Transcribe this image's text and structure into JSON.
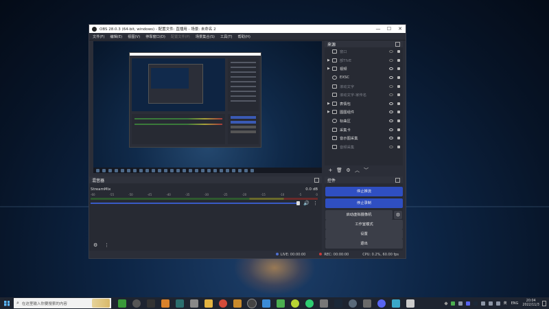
{
  "window": {
    "title": "OBS 28.0.3 (64-bit, windows) - 配置文件: 直播用 - 场景: 未命名 2",
    "controls": [
      "—",
      "☐",
      "✕"
    ]
  },
  "menu": [
    {
      "label": "文件(F)",
      "enabled": true
    },
    {
      "label": "编辑(E)",
      "enabled": true
    },
    {
      "label": "视图(V)",
      "enabled": true
    },
    {
      "label": "停靠窗口(D)",
      "enabled": true
    },
    {
      "label": "配置文件(P)",
      "enabled": false
    },
    {
      "label": "场景集合(S)",
      "enabled": true
    },
    {
      "label": "工具(T)",
      "enabled": true
    },
    {
      "label": "帮助(H)",
      "enabled": true
    }
  ],
  "sources": {
    "title": "来源",
    "items": [
      {
        "label": "窗口",
        "group": false,
        "visible": false
      },
      {
        "label": "部TIVE",
        "group": true,
        "visible": false
      },
      {
        "label": "视频",
        "group": true,
        "visible": true
      },
      {
        "label": "EXSC",
        "group": false,
        "visible": true
      },
      {
        "label": "滚动文字",
        "group": false,
        "visible": false
      },
      {
        "label": "滚动文字-家传名",
        "group": false,
        "visible": false
      },
      {
        "label": "表情包",
        "group": true,
        "visible": true
      },
      {
        "label": "图图组件",
        "group": true,
        "visible": true
      },
      {
        "label": "标曲区",
        "group": false,
        "visible": true
      },
      {
        "label": "采集卡",
        "group": false,
        "visible": true
      },
      {
        "label": "音示图采集",
        "group": false,
        "visible": true
      },
      {
        "label": "音频采集",
        "group": false,
        "visible": false
      }
    ],
    "tools": [
      "+",
      "🗑",
      "⚙",
      "︿",
      "﹀"
    ]
  },
  "mixer": {
    "title": "混音器",
    "channel": {
      "name": "StreamMix",
      "db": "0.0 dB"
    },
    "scale": [
      "-60",
      "-55",
      "-50",
      "-45",
      "-40",
      "-35",
      "-30",
      "-25",
      "-20",
      "-15",
      "-10",
      "-5",
      "0"
    ],
    "volume_fraction": 1.0
  },
  "controls": {
    "title": "控件",
    "stop_stream": "停止推流",
    "stop_record": "停止录制",
    "virtual_cam": "启动虚拟摄像机",
    "studio_mode": "工作室模式",
    "settings": "设置",
    "exit": "退出"
  },
  "status": {
    "live": "LIVE: 00:00:00",
    "rec": "REC: 00:00:00",
    "cpu": "CPU: 0.2%, 60.00 fps"
  },
  "taskbar": {
    "search_placeholder": "在这里输入你要搜索的内容",
    "lang": "ENG",
    "tray_text": "英",
    "time": "20:04",
    "date": "2022/11/3"
  },
  "colors": {
    "accent": "#2f4fc2",
    "panel": "#272a33",
    "window": "#2b2e38"
  }
}
